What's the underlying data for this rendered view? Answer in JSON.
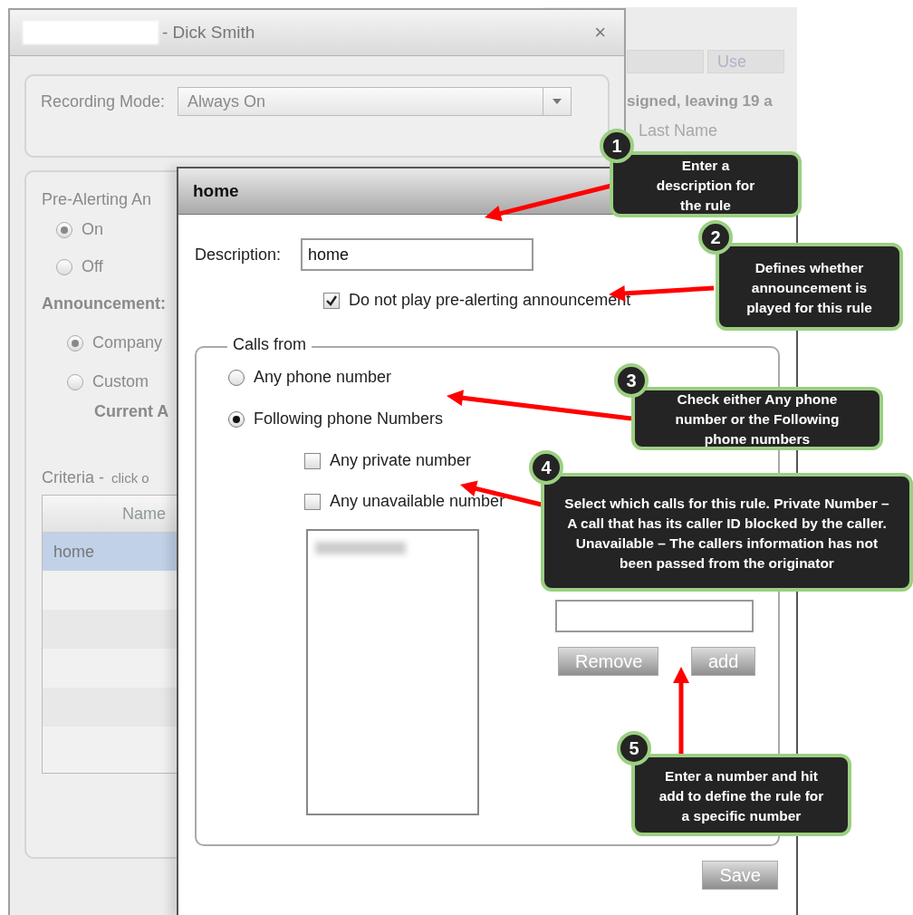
{
  "background_page": {
    "tab_label": "Use",
    "notice": "signed, leaving 19 a",
    "column_label": "Last Name"
  },
  "window": {
    "title": "- Dick Smith",
    "close": "×"
  },
  "recording_mode": {
    "label": "Recording Mode:",
    "value": "Always On"
  },
  "pre_alerting": {
    "label": "Pre-Alerting An",
    "options": [
      {
        "label": "On",
        "selected": true
      },
      {
        "label": "Off",
        "selected": false
      }
    ]
  },
  "announcement": {
    "label": "Announcement:",
    "options": [
      {
        "label": "Company",
        "selected": true
      },
      {
        "label": "Custom",
        "selected": false
      }
    ],
    "current": "Current A"
  },
  "criteria": {
    "label": "Criteria -",
    "hint": "click o",
    "column": "Name",
    "rows": [
      {
        "name": "home",
        "selected": true
      }
    ]
  },
  "dialog": {
    "title": "home",
    "description": {
      "label": "Description:",
      "value": "home"
    },
    "skip_announcement": {
      "label": "Do not play pre-alerting announcement",
      "checked": true
    },
    "calls_from": {
      "legend": "Calls from",
      "options": [
        {
          "label": "Any phone number",
          "selected": false
        },
        {
          "label": "Following phone Numbers",
          "selected": true
        }
      ],
      "filters": [
        {
          "label": "Any private number",
          "checked": false
        },
        {
          "label": "Any unavailable number",
          "checked": false
        }
      ],
      "buttons": [
        "Remove",
        "add"
      ]
    },
    "save": "Save"
  },
  "callouts": [
    {
      "number": "1",
      "text": "Enter a description for the rule"
    },
    {
      "number": "2",
      "text": "Defines whether announcement is played for this rule"
    },
    {
      "number": "3",
      "text": "Check either Any phone number or the Following phone numbers"
    },
    {
      "number": "4",
      "text": "Select which calls for this rule. Private Number – A call that has its caller ID blocked by the caller. Unavailable – The callers information has not been passed from the originator"
    },
    {
      "number": "5",
      "text": "Enter a number and hit add to define the rule for a specific number"
    }
  ]
}
